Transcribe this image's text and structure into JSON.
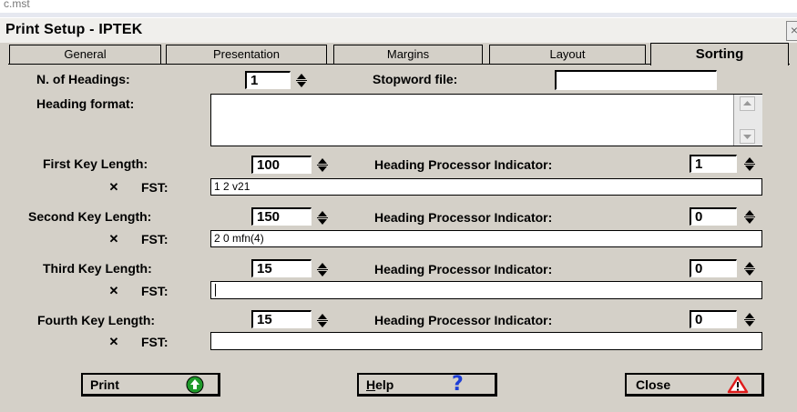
{
  "background_window": {
    "title": "c.mst"
  },
  "dialog": {
    "title": "Print Setup - IPTEK",
    "close_glyph": "×"
  },
  "tabs": [
    {
      "label": "General"
    },
    {
      "label": "Presentation"
    },
    {
      "label": "Margins"
    },
    {
      "label": "Layout"
    },
    {
      "label": "Sorting"
    }
  ],
  "active_tab": "Sorting",
  "form": {
    "n_headings_label": "N. of Headings:",
    "n_headings_value": "1",
    "stopword_label": "Stopword file:",
    "stopword_value": "",
    "heading_format_label": "Heading format:",
    "heading_format_value": "",
    "fst_label": "FST:",
    "hpi_label": "Heading Processor Indicator:",
    "keys": [
      {
        "label": "First Key Length:",
        "length": "100",
        "hpi": "1",
        "fst_checked": true,
        "fst_value": "1 2 v21"
      },
      {
        "label": "Second Key Length:",
        "length": "150",
        "hpi": "0",
        "fst_checked": true,
        "fst_value": "2 0 mfn(4)"
      },
      {
        "label": "Third Key Length:",
        "length": "15",
        "hpi": "0",
        "fst_checked": true,
        "fst_value": ""
      },
      {
        "label": "Fourth Key Length:",
        "length": "15",
        "hpi": "0",
        "fst_checked": true,
        "fst_value": ""
      }
    ]
  },
  "buttons": {
    "print": {
      "label": "Print",
      "icon": "green-up-arrow-icon"
    },
    "help": {
      "label": "Help",
      "icon": "question-mark-icon"
    },
    "close": {
      "label": "Close",
      "icon": "warning-triangle-icon"
    }
  },
  "colors": {
    "dialog_bg": "#d4d0c8",
    "print_icon": "#1f9a2a",
    "help_icon": "#1e3fd6",
    "close_icon": "#e01b1b"
  }
}
